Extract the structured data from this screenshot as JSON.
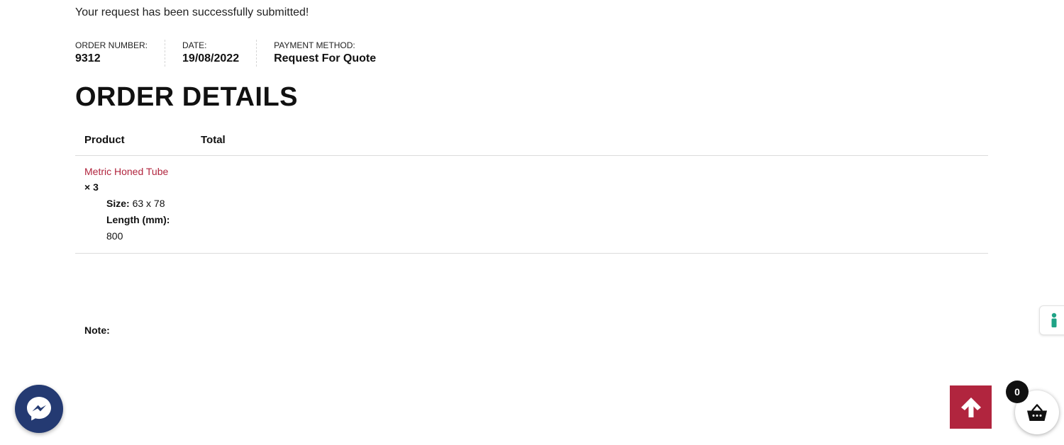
{
  "notice": "Your request has been successfully submitted!",
  "overview": [
    {
      "label": "ORDER NUMBER:",
      "value": "9312"
    },
    {
      "label": "DATE:",
      "value": "19/08/2022"
    },
    {
      "label": "PAYMENT METHOD:",
      "value": "Request For Quote"
    }
  ],
  "order_details": {
    "title": "ORDER DETAILS",
    "columns": {
      "product": "Product",
      "total": "Total"
    },
    "items": [
      {
        "name": "Metric Honed Tube",
        "quantity": "× 3",
        "meta": [
          {
            "key": "Size:",
            "value": "63 x 78"
          },
          {
            "key": "Length (mm):",
            "value": "800"
          }
        ],
        "total": ""
      }
    ]
  },
  "note_label": "Note:",
  "cart": {
    "count": "0"
  },
  "colors": {
    "accent": "#b1253e",
    "messenger": "#243a72",
    "cart_badge": "#111111",
    "accessibility": "#1fa386"
  },
  "icons": [
    "messenger-icon",
    "arrow-up-icon",
    "basket-icon",
    "accessibility-icon"
  ]
}
